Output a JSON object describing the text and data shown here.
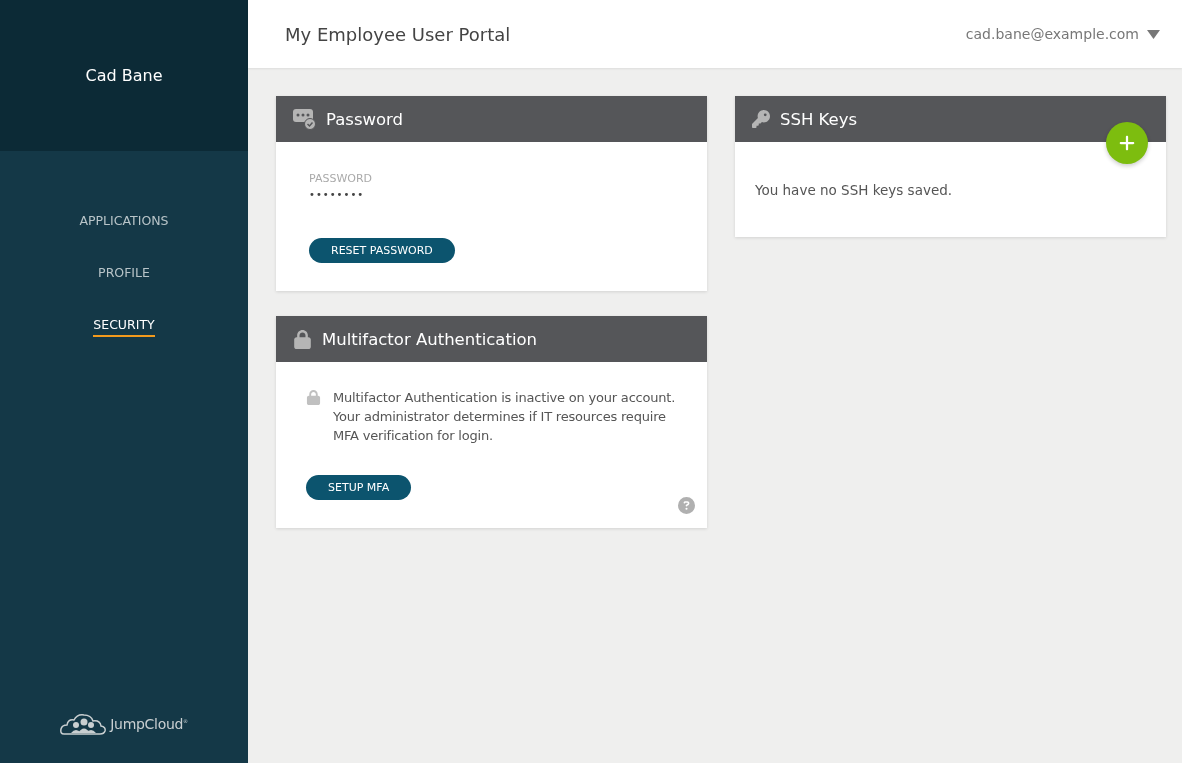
{
  "sidebar": {
    "user_name": "Cad Bane",
    "nav": [
      {
        "label": "APPLICATIONS",
        "selected": false
      },
      {
        "label": "PROFILE",
        "selected": false
      },
      {
        "label": "SECURITY",
        "selected": true
      }
    ],
    "logo_text": "JumpCloud$^{®}$"
  },
  "header": {
    "title": "My Employee User Portal",
    "account": "cad.bane@example.com"
  },
  "password_card": {
    "title": "Password",
    "field_label": "PASSWORD",
    "field_value": "••••••••",
    "button": "RESET PASSWORD"
  },
  "mfa_card": {
    "title": "Multifactor Authentication",
    "message": "Multifactor Authentication is inactive on your account. Your administrator determines if IT resources require MFA verification for login.",
    "button": "SETUP MFA"
  },
  "ssh_card": {
    "title": "SSH Keys",
    "message": "You have no SSH keys saved."
  }
}
